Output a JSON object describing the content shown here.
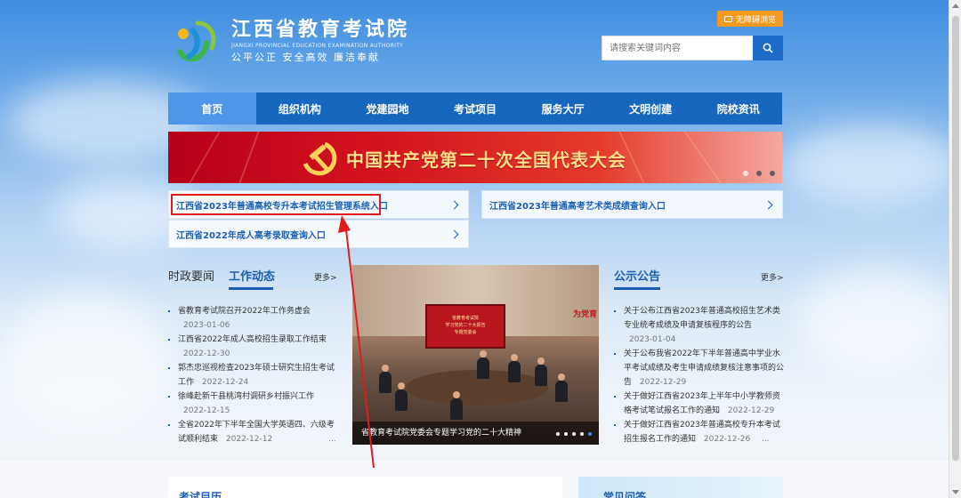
{
  "header": {
    "site_title": "江西省教育考试院",
    "site_title_en": "JIANGXI PROVINCIAL EDUCATION EXAMINATION AUTHORITY",
    "slogan": "公平公正  安全高效  廉洁奉献",
    "accessibility_label": "无障碍浏览",
    "search_placeholder": "请搜索关键词内容"
  },
  "nav": {
    "items": [
      {
        "label": "首页",
        "active": true
      },
      {
        "label": "组织机构"
      },
      {
        "label": "党建园地"
      },
      {
        "label": "考试项目"
      },
      {
        "label": "服务大厅"
      },
      {
        "label": "文明创建"
      },
      {
        "label": "院校资讯"
      }
    ]
  },
  "banner": {
    "title": "中国共产党第二十次全国代表大会"
  },
  "quick_links": [
    "江西省2023年普通高校专升本考试招生管理系统入口",
    "江西省2023年普通高考艺术类成绩查询入口",
    "江西省2022年成人高考录取查询入口"
  ],
  "news": {
    "tab_inactive": "时政要闻",
    "tab_active": "工作动态",
    "more": "更多>",
    "items": [
      {
        "title": "省教育考试院召开2022年工作务虚会",
        "date": "2023-01-06"
      },
      {
        "title": "江西省2022年成人高校招生录取工作结束",
        "date": "2022-12-30"
      },
      {
        "title": "郭杰忠巡视检查2023年硕士研究生招生考试工作",
        "date": "2022-12-24"
      },
      {
        "title": "徐峰赴新干县桃湾村调研乡村振兴工作",
        "date": "2022-12-15"
      },
      {
        "title": "全省2022年下半年全国大学英语四、六级考试顺利结束",
        "date": "2022-12-12",
        "ellipsis": "..."
      }
    ]
  },
  "photo": {
    "caption": "省教育考试院党委会专题学习党的二十大精神",
    "screen_line1": "省教育考试院",
    "screen_line2": "学习党的二十大报告",
    "screen_line3": "专题党委会",
    "wall_text": "为党育"
  },
  "notice": {
    "title": "公示公告",
    "more": "更多>",
    "items": [
      {
        "title": "关于公布江西省2023年普通高校招生艺术类专业统考成绩及申请复核程序的公告",
        "date": "2023-01-04"
      },
      {
        "title": "关于公布我省2022年下半年普通高中学业水平考试成绩及考生申请成绩复核注意事项的公告",
        "date": "2022-12-29"
      },
      {
        "title": "关于做好江西省2023年上半年中小学教师资格考试笔试报名工作的通知",
        "date": "2022-12-29"
      },
      {
        "title": "关于做好江西省2023年普通高校专升本考试招生报名工作的通知",
        "date": "2022-12-26",
        "ellipsis": "..."
      }
    ]
  },
  "bottom": {
    "panel_left": "考试目历",
    "panel_right": "常见问答"
  },
  "colors": {
    "nav_blue": "#1767bf",
    "nav_active": "#4f95e8",
    "link_blue": "#1b5eb3",
    "annotation_red": "#e01b1b",
    "access_orange": "#f39a1f"
  }
}
